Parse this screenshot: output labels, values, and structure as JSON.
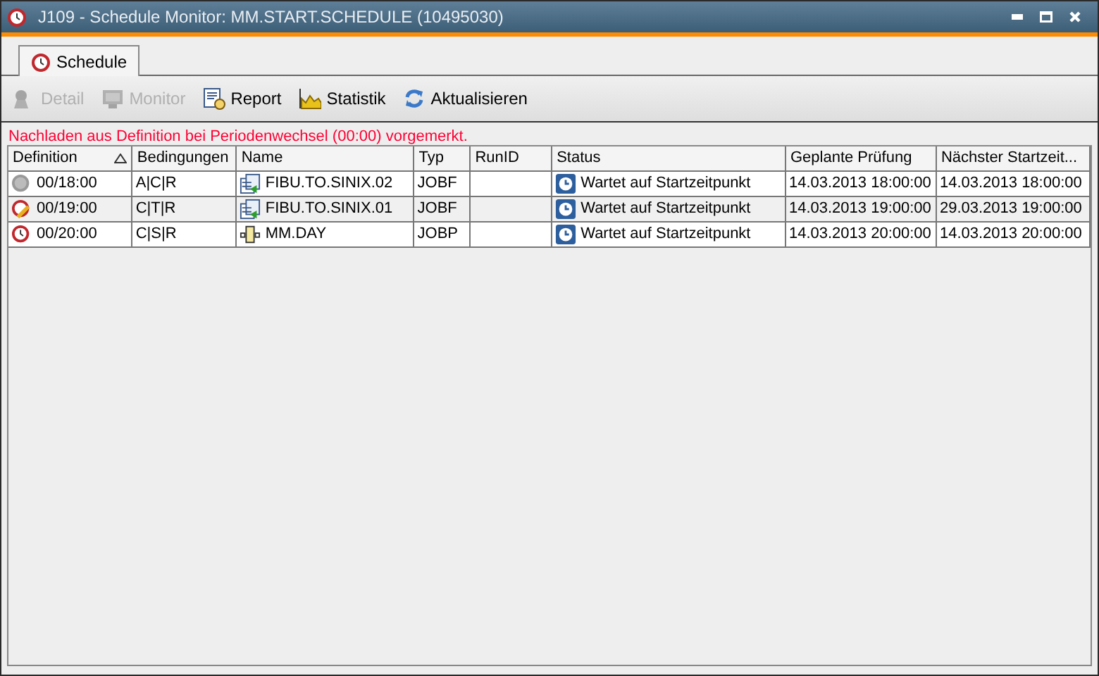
{
  "window": {
    "title": "J109 - Schedule Monitor: MM.START.SCHEDULE (10495030)"
  },
  "tabs": [
    {
      "label": "Schedule",
      "selected": true
    }
  ],
  "toolbar": [
    {
      "label": "Detail",
      "kind": "detail",
      "disabled": true
    },
    {
      "label": "Monitor",
      "kind": "monitor",
      "disabled": true
    },
    {
      "label": "Report",
      "kind": "report",
      "disabled": false
    },
    {
      "label": "Statistik",
      "kind": "chart",
      "disabled": false
    },
    {
      "label": "Aktualisieren",
      "kind": "refresh",
      "disabled": false
    }
  ],
  "message": "Nachladen aus Definition bei Periodenwechsel (00:00) vorgemerkt.",
  "table": {
    "columns": [
      {
        "label": "Definition",
        "sorted": true
      },
      {
        "label": "Bedingungen",
        "sorted": false
      },
      {
        "label": "Name",
        "sorted": false
      },
      {
        "label": "Typ",
        "sorted": false
      },
      {
        "label": "RunID",
        "sorted": false
      },
      {
        "label": "Status",
        "sorted": false
      },
      {
        "label": "Geplante Prüfung",
        "sorted": false
      },
      {
        "label": "Nächster Startzeit...",
        "sorted": false
      }
    ],
    "rows": [
      {
        "definition": {
          "text": "00/18:00",
          "kind": "inactive"
        },
        "conditions": "A|C|R",
        "name": {
          "text": "FIBU.TO.SINIX.02",
          "kind": "jobf"
        },
        "type": "JOBF",
        "status": "Wartet auf Startzeitpunkt",
        "planned": "14.03.2013 18:00:00",
        "next": "14.03.2013 18:00:00"
      },
      {
        "definition": {
          "text": "00/19:00",
          "kind": "edited"
        },
        "conditions": "C|T|R",
        "name": {
          "text": "FIBU.TO.SINIX.01",
          "kind": "jobf"
        },
        "type": "JOBF",
        "status": "Wartet auf Startzeitpunkt",
        "planned": "14.03.2013 19:00:00",
        "next": "29.03.2013 19:00:00"
      },
      {
        "definition": {
          "text": "00/20:00",
          "kind": "active"
        },
        "conditions": "C|S|R",
        "name": {
          "text": "MM.DAY",
          "kind": "jobp"
        },
        "type": "JOBP",
        "status": "Wartet auf Startzeitpunkt",
        "planned": "14.03.2013 20:00:00",
        "next": "14.03.2013 20:00:00"
      }
    ]
  }
}
